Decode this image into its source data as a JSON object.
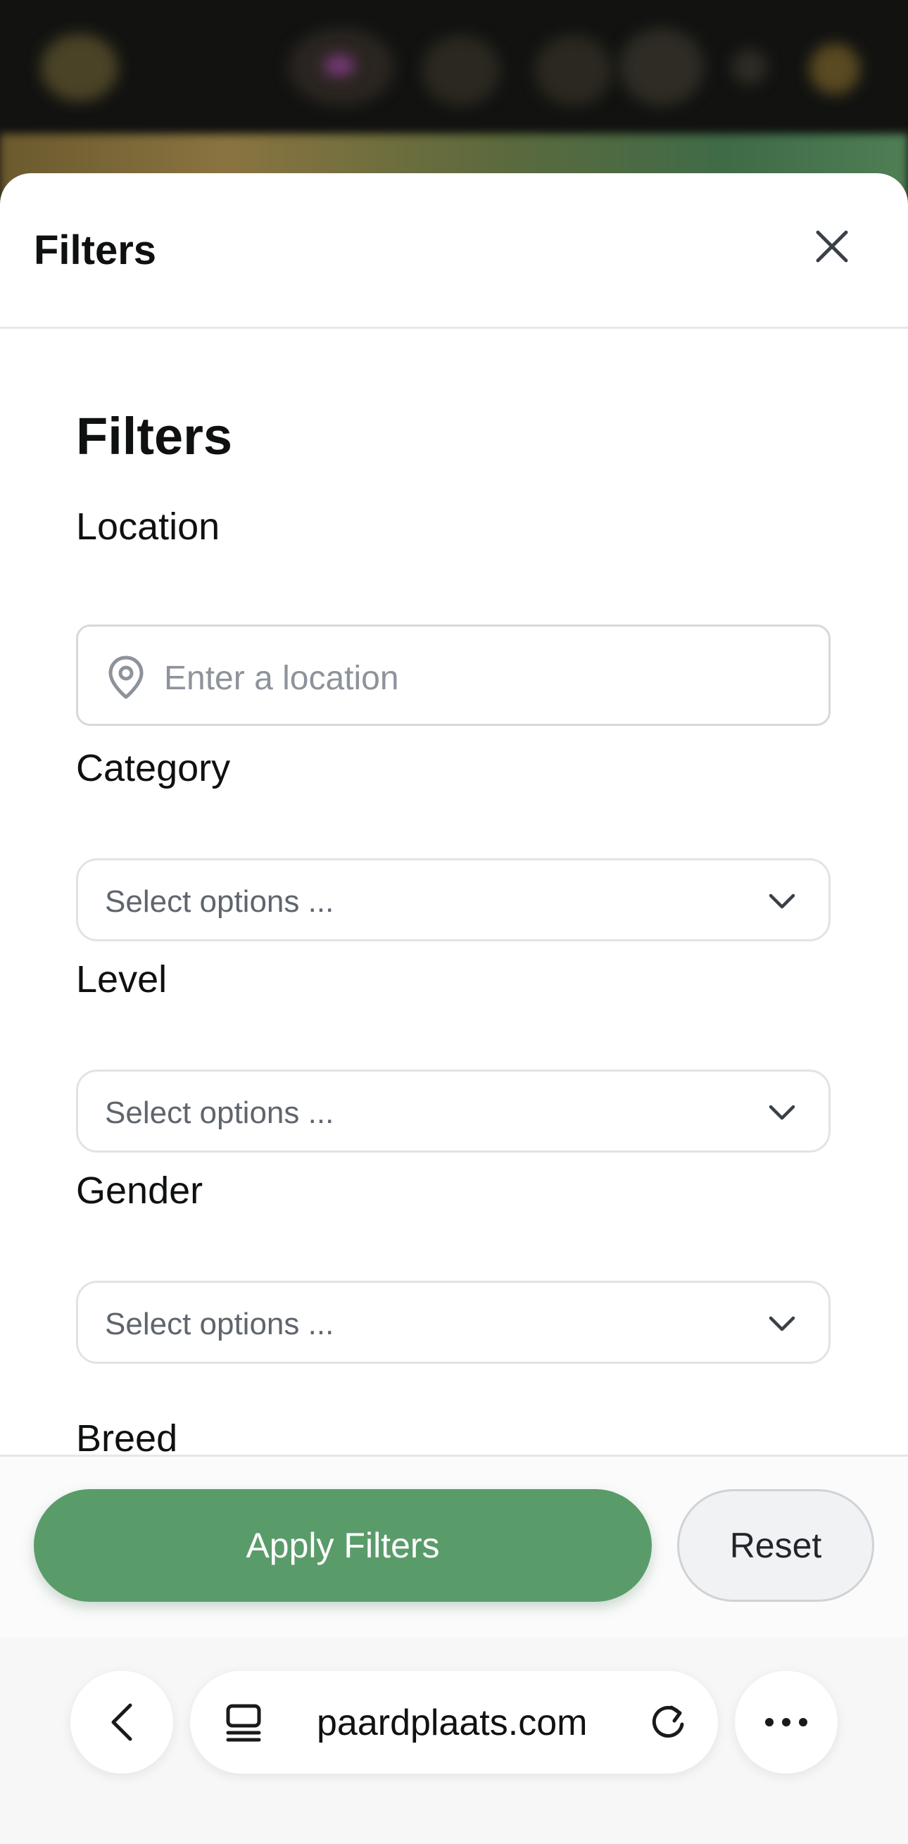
{
  "header": {
    "title": "Filters",
    "close_icon": "close-icon"
  },
  "content": {
    "title": "Filters",
    "location": {
      "label": "Location",
      "placeholder": "Enter a location",
      "icon": "location-pin-icon"
    },
    "category": {
      "label": "Category",
      "placeholder": "Select options ..."
    },
    "level": {
      "label": "Level",
      "placeholder": "Select options ..."
    },
    "gender": {
      "label": "Gender",
      "placeholder": "Select options ..."
    },
    "breed": {
      "label": "Breed"
    }
  },
  "actions": {
    "apply_label": "Apply Filters",
    "reset_label": "Reset"
  },
  "browser": {
    "url": "paardplaats.com"
  },
  "colors": {
    "accent": "#5a9b6a",
    "reset_bg": "#f1f2f4",
    "placeholder": "#8d939b",
    "border": "#d6d8db"
  }
}
